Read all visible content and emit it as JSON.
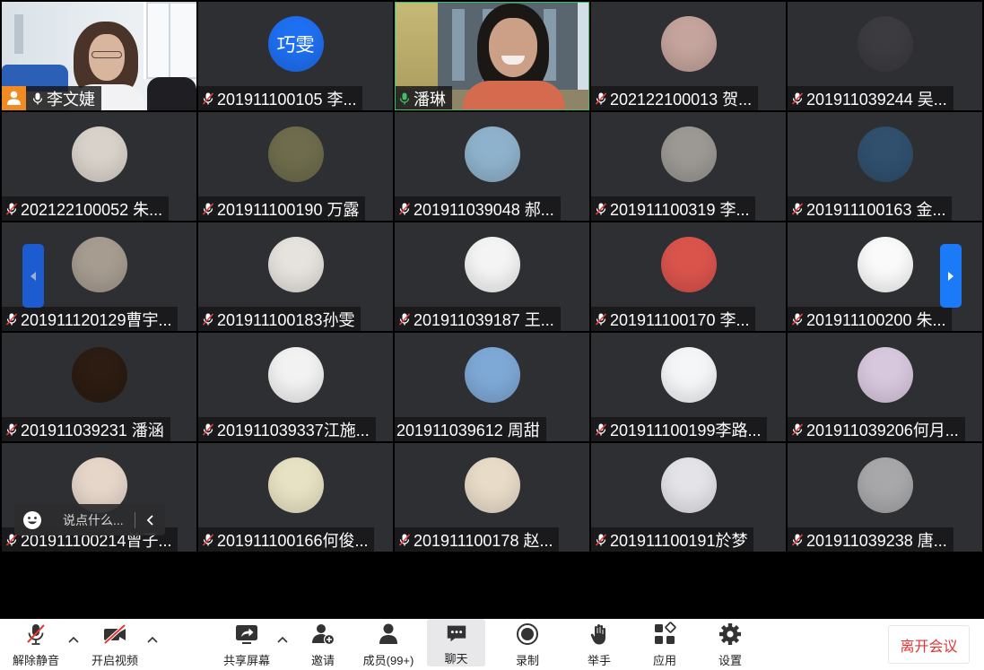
{
  "colors": {
    "tile_bg": "#2e2f33",
    "speaking": "#3dbf6a",
    "host": "#f18a21",
    "accent": "#1a73e8",
    "leave": "#e23434",
    "muted_slash": "#e84040"
  },
  "tiles": [
    {
      "name": "李文婕",
      "mic": "on",
      "host": true,
      "feed": "video"
    },
    {
      "name": "201911100105 李...",
      "mic": "muted",
      "avatar_text": "巧雯",
      "avatar_color": "#1e6ff1"
    },
    {
      "name": "潘琳",
      "mic": "on",
      "speaking": true,
      "feed": "video"
    },
    {
      "name": "202122100013 贺...",
      "mic": "muted",
      "avatar_color": "#c4a49c"
    },
    {
      "name": "201911039244 吴...",
      "mic": "muted",
      "avatar_color": "#3c3c40"
    },
    {
      "name": "202122100052 朱...",
      "mic": "muted",
      "avatar_color": "#d9d2ca"
    },
    {
      "name": "201911100190 万露",
      "mic": "muted",
      "avatar_color": "#6e6c4c"
    },
    {
      "name": "201911039048 郝...",
      "mic": "muted",
      "avatar_color": "#8fb2cc"
    },
    {
      "name": "201911100319 李...",
      "mic": "muted",
      "avatar_color": "#9c9894"
    },
    {
      "name": "201911100163 金...",
      "mic": "muted",
      "avatar_color": "#30506e"
    },
    {
      "name": "201911120129曹宇...",
      "mic": "muted",
      "avatar_color": "#a69c90"
    },
    {
      "name": "201911100183孙雯",
      "mic": "muted",
      "avatar_color": "#e6e2de"
    },
    {
      "name": "201911039187 王...",
      "mic": "muted",
      "avatar_color": "#f4f4f4"
    },
    {
      "name": "201911100170 李...",
      "mic": "muted",
      "avatar_color": "#da544c"
    },
    {
      "name": "201911100200 朱...",
      "mic": "muted",
      "avatar_color": "#fafafa"
    },
    {
      "name": "201911039231 潘涵",
      "mic": "muted",
      "avatar_color": "#2c1c12"
    },
    {
      "name": "201911039337江施...",
      "mic": "muted",
      "avatar_color": "#f2f2f2"
    },
    {
      "name": "201911039612 周甜",
      "mic": "none",
      "avatar_color": "#7ea8d6"
    },
    {
      "name": "201911100199李路...",
      "mic": "muted",
      "avatar_color": "#f4f6f8"
    },
    {
      "name": "201911039206何月...",
      "mic": "muted",
      "avatar_color": "#d8c8de"
    },
    {
      "name": "201911100214曾子...",
      "mic": "muted",
      "avatar_color": "#e6d6ca"
    },
    {
      "name": "201911100166何俊...",
      "mic": "muted",
      "avatar_color": "#e8e2c4"
    },
    {
      "name": "201911100178 赵...",
      "mic": "muted",
      "avatar_color": "#e8dcc8"
    },
    {
      "name": "201911100191於梦",
      "mic": "muted",
      "avatar_color": "#e4e4e8"
    },
    {
      "name": "201911039238 唐...",
      "mic": "muted",
      "avatar_color": "#a8a8aa"
    }
  ],
  "chat": {
    "placeholder": "说点什么..."
  },
  "toolbar": {
    "items": [
      {
        "label": "解除静音",
        "icon": "mic-muted-icon"
      },
      {
        "label": "开启视频",
        "icon": "video-off-icon"
      },
      {
        "label": "共享屏幕",
        "icon": "share-screen-icon"
      },
      {
        "label": "邀请",
        "icon": "invite-icon"
      },
      {
        "label": "成员(99+)",
        "icon": "members-icon"
      },
      {
        "label": "聊天",
        "icon": "chat-icon",
        "active": true
      },
      {
        "label": "录制",
        "icon": "record-icon"
      },
      {
        "label": "举手",
        "icon": "raise-hand-icon"
      },
      {
        "label": "应用",
        "icon": "apps-icon"
      },
      {
        "label": "设置",
        "icon": "settings-icon"
      }
    ],
    "leave_label": "离开会议"
  }
}
